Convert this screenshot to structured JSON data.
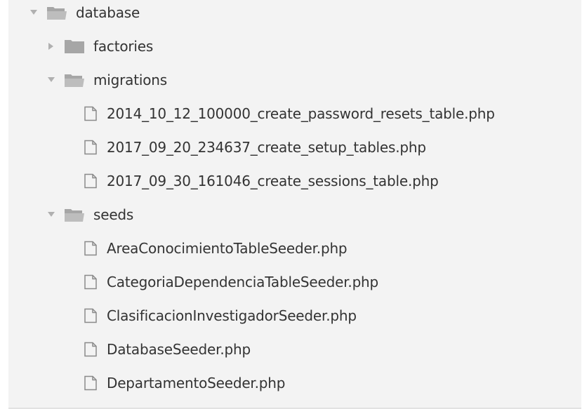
{
  "tree": {
    "root": {
      "label": "database",
      "expanded": true
    },
    "factories": {
      "label": "factories",
      "expanded": false
    },
    "migrations": {
      "label": "migrations",
      "expanded": true,
      "files": [
        "2014_10_12_100000_create_password_resets_table.php",
        "2017_09_20_234637_create_setup_tables.php",
        "2017_09_30_161046_create_sessions_table.php"
      ]
    },
    "seeds": {
      "label": "seeds",
      "expanded": true,
      "files": [
        "AreaConocimientoTableSeeder.php",
        "CategoriaDependenciaTableSeeder.php",
        "ClasificacionInvestigadorSeeder.php",
        "DatabaseSeeder.php",
        "DepartamentoSeeder.php"
      ]
    }
  },
  "icons": {
    "expanded_arrow": "triangle-down-icon",
    "collapsed_arrow": "triangle-right-icon",
    "open_folder": "folder-open-icon",
    "closed_folder": "folder-icon",
    "file": "file-icon"
  },
  "colors": {
    "panel_bg": "#f3f3f3",
    "text": "#333333",
    "icon": "#a6a6a6",
    "arrow": "#b0b0b0"
  }
}
